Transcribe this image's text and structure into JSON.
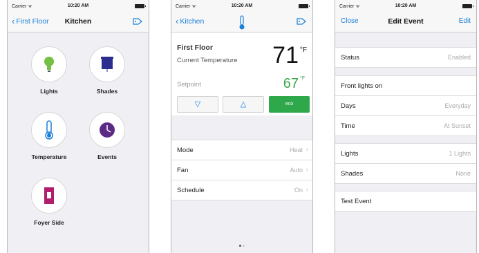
{
  "status_bar": {
    "carrier": "Carrier ᯤ",
    "time": "10:20 AM"
  },
  "screen1": {
    "back_label": "First Floor",
    "title": "Kitchen",
    "tiles": [
      {
        "label": "Lights",
        "icon": "lightbulb-icon",
        "color": "#74c043"
      },
      {
        "label": "Shades",
        "icon": "shades-icon",
        "color": "#2b2e8f"
      },
      {
        "label": "Temperature",
        "icon": "thermometer-icon",
        "color": "#1a7fd8"
      },
      {
        "label": "Events",
        "icon": "clock-icon",
        "color": "#5b2a84"
      },
      {
        "label": "Foyer Side",
        "icon": "switch-icon",
        "color": "#b21e6e"
      }
    ]
  },
  "screen2": {
    "back_label": "Kitchen",
    "floor": "First Floor",
    "current_temp_label": "Current Temperature",
    "current_temp": "71",
    "current_unit": "°F",
    "setpoint_label": "Setpoint",
    "setpoint": "67",
    "setpoint_unit": "°F",
    "down_label": "▽",
    "up_label": "△",
    "eco_label": "eco",
    "rows": [
      {
        "label": "Mode",
        "value": "Heat"
      },
      {
        "label": "Fan",
        "value": "Auto"
      },
      {
        "label": "Schedule",
        "value": "On"
      }
    ],
    "page_count": 2,
    "active_page": 1
  },
  "screen3": {
    "close_label": "Close",
    "title": "Edit Event",
    "edit_label": "Edit",
    "status_label": "Status",
    "status_value": "Enabled",
    "event_name": "Front lights on",
    "days_label": "Days",
    "days_value": "Everyday",
    "time_label": "Time",
    "time_value": "At Sunset",
    "lights_label": "Lights",
    "lights_value": "1 Lights",
    "shades_label": "Shades",
    "shades_value": "None",
    "test_label": "Test Event"
  },
  "colors": {
    "accent": "#1a7fd8",
    "eco_green": "#2fa84c"
  }
}
